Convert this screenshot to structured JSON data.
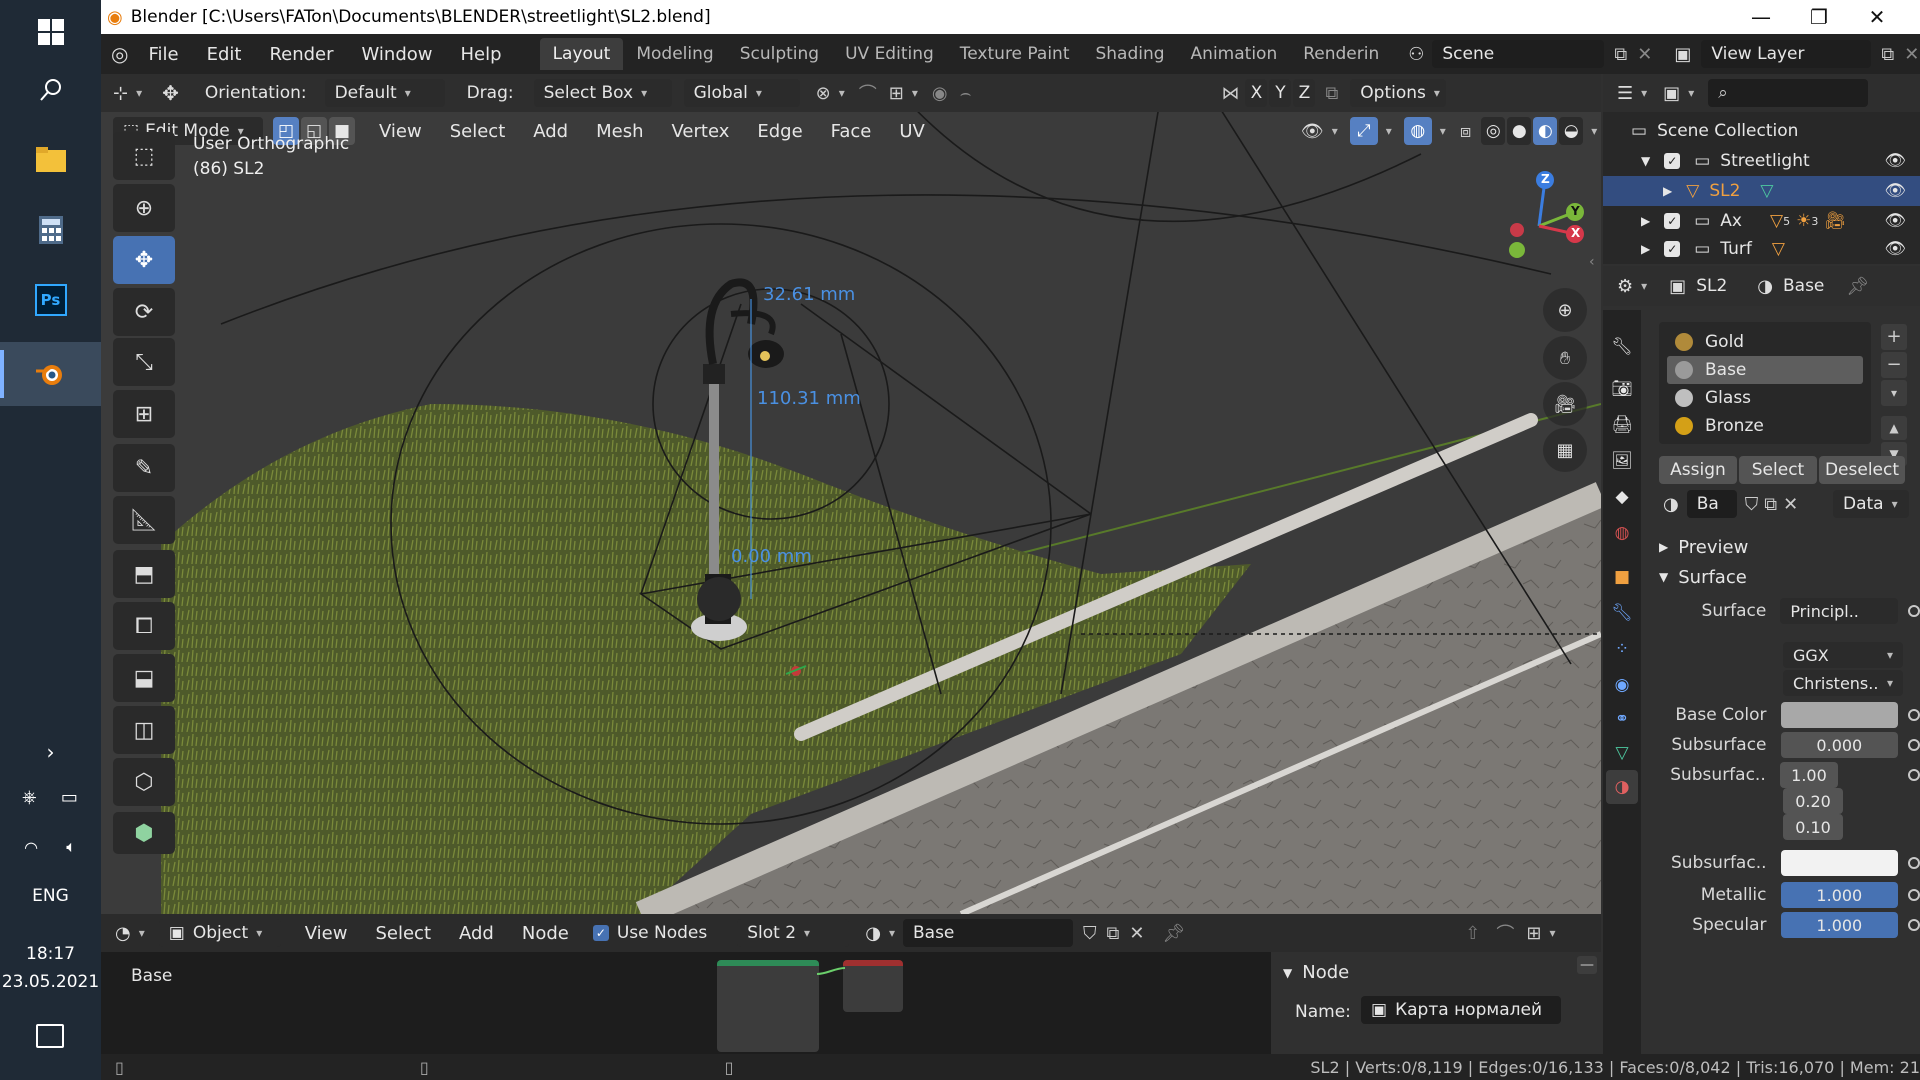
{
  "taskbar": {
    "lang": "ENG",
    "time": "18:17",
    "date": "23.05.2021"
  },
  "window": {
    "title": "Blender [C:\\Users\\FATon\\Documents\\BLENDER\\streetlight\\SL2.blend]"
  },
  "topbar": {
    "menus": [
      "File",
      "Edit",
      "Render",
      "Window",
      "Help"
    ],
    "workspaces": [
      "Layout",
      "Modeling",
      "Sculpting",
      "UV Editing",
      "Texture Paint",
      "Shading",
      "Animation",
      "Renderin"
    ],
    "active_workspace": "Layout",
    "scene": "Scene",
    "view_layer": "View Layer"
  },
  "tool_header": {
    "orientation_label": "Orientation:",
    "orientation_value": "Default",
    "drag_label": "Drag:",
    "drag_value": "Select Box",
    "transform_orientation": "Global",
    "axes": [
      "X",
      "Y",
      "Z"
    ],
    "options": "Options"
  },
  "viewport_header": {
    "mode": "Edit Mode",
    "menus": [
      "View",
      "Select",
      "Add",
      "Mesh",
      "Vertex",
      "Edge",
      "Face",
      "UV"
    ]
  },
  "viewport": {
    "view_name": "User Orthographic",
    "object_info": "(86) SL2",
    "measures": [
      "32.61 mm",
      "110.31 mm",
      "0.00 mm"
    ],
    "gizmo_axes": [
      "Z",
      "Y",
      "X"
    ]
  },
  "outliner": {
    "root": "Scene Collection",
    "rows": [
      {
        "name": "Streetlight",
        "selected": false
      },
      {
        "name": "SL2",
        "selected": true
      },
      {
        "name": "Ax",
        "selected": false
      },
      {
        "name": "Turf",
        "selected": false
      }
    ],
    "badges": [
      "5",
      "3"
    ]
  },
  "properties": {
    "object": "SL2",
    "material": "Base",
    "slots": [
      {
        "name": "Gold",
        "color": "#b08a3a"
      },
      {
        "name": "Base",
        "color": "#9a9a9a"
      },
      {
        "name": "Glass",
        "color": "#bfbfbf"
      },
      {
        "name": "Bronze",
        "color": "#d4a017"
      }
    ],
    "actions": [
      "Assign",
      "Select",
      "Deselect"
    ],
    "mat_field": "Ba",
    "link": "Data",
    "sections": [
      "Preview",
      "Surface"
    ],
    "surface_label": "Surface",
    "surface_value": "Principl..",
    "dist1": "GGX",
    "dist2": "Christens..",
    "rows": [
      {
        "label": "Base Color",
        "value": ""
      },
      {
        "label": "Subsurface",
        "value": "0.000"
      },
      {
        "label": "Subsurfac..",
        "value": "1.00"
      },
      {
        "label": "",
        "value": "0.20"
      },
      {
        "label": "",
        "value": "0.10"
      },
      {
        "label": "Subsurfac..",
        "value": ""
      },
      {
        "label": "Metallic",
        "value": "1.000"
      },
      {
        "label": "Specular",
        "value": "1.000"
      }
    ]
  },
  "node_editor": {
    "type": "Object",
    "menus": [
      "View",
      "Select",
      "Add",
      "Node"
    ],
    "use_nodes": "Use Nodes",
    "slot": "Slot 2",
    "material": "Base",
    "breadcrumb": "Base",
    "panel_title": "Node",
    "name_label": "Name:",
    "name_value": "Карта нормалей"
  },
  "status": {
    "text": "SL2 | Verts:0/8,119 | Edges:0/16,133 | Faces:0/8,042 | Tris:16,070 | Mem: 21"
  },
  "colors": {
    "accent": "#4772b3",
    "selected_row": "#334d80",
    "header": "#232323"
  }
}
